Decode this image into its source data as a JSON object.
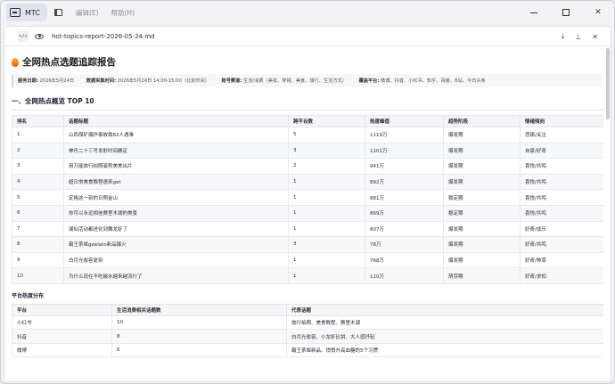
{
  "titlebar": {
    "app_name": "MTC",
    "menu": [
      "编辑(E)",
      "帮助(H)"
    ]
  },
  "document": {
    "filename": "hot-topics-report-2026-05-24.md",
    "title": "全网热点选题追踪报告",
    "meta": {
      "service_date_label": "服务日期:",
      "service_date": "2026年5月24日",
      "collect_time_label": "数据采集时间:",
      "collect_time": "2026年5月24日 14:00-15:00（北京时间）",
      "account_label": "账号赛道:",
      "account": "生活/消费（美妆、穿搭、美食、旅行、生活方式）",
      "platforms_label": "覆盖平台:",
      "platforms": "微博、抖音、小红书、知乎、百度、B站、今日头条"
    },
    "section1_title": "一、全网热点概览 TOP 10",
    "top10": {
      "headers": [
        "排名",
        "话题标题",
        "跨平台数",
        "热度峰值",
        "趋势阶段",
        "情绪倾向"
      ],
      "rows": [
        [
          "1",
          "山西煤矿爆炸事故致82人遇难",
          "5",
          "1119万",
          "爆发期",
          "悲痛/关注"
        ],
        [
          "2",
          "神舟二十三号发射时间确定",
          "3",
          "1101万",
          "爆发期",
          "自豪/好奇"
        ],
        [
          "3",
          "用万能旅行拍照姿势美美出片",
          "2",
          "941万",
          "爆发期",
          "喜悦/共鸣"
        ],
        [
          "4",
          "超日常美食教程速来get",
          "1",
          "892万",
          "爆发期",
          "喜悦/共鸣"
        ],
        [
          "5",
          "定格这一刻的日照金山",
          "1",
          "881万",
          "稳定期",
          "喜悦/共鸣"
        ],
        [
          "6",
          "你可以永远相信赛里木湖的美景",
          "1",
          "869万",
          "稳定期",
          "喜悦/共鸣"
        ],
        [
          "7",
          "湖仙活动都进化到舞龙虾了",
          "1",
          "807万",
          "爆发期",
          "好奇/成乐"
        ],
        [
          "8",
          "霸王茶姬geelato新品爆火",
          "3",
          "78万",
          "爆发期",
          "好奇/共鸣"
        ],
        [
          "9",
          "白月光收容复刻",
          "1",
          "768万",
          "爆发期",
          "好奇/种草"
        ],
        [
          "10",
          "为什么现在不吃碳水越来越流行了",
          "1",
          "110万",
          "萌芽期",
          "好奇/求知"
        ]
      ]
    },
    "platform_section_title": "平台热度分布",
    "platform_table": {
      "headers": [
        "平台",
        "生活消费相关话题数",
        "代表话题"
      ],
      "rows": [
        [
          "小红书",
          "10",
          "旅行拍照、美食教程、赛里木湖"
        ],
        [
          "抖音",
          "8",
          "白月光收容、小龙虾比拼、大人感抒轻"
        ],
        [
          "微博",
          "6",
          "霸王茶姬新品、悄悄升高血糖的5个习惯"
        ]
      ]
    }
  }
}
